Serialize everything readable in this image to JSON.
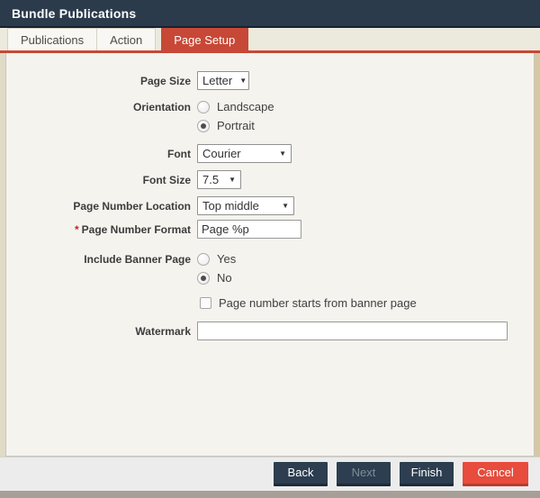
{
  "window": {
    "title": "Bundle Publications"
  },
  "tabs": [
    {
      "label": "Publications",
      "active": false
    },
    {
      "label": "Action",
      "active": false
    },
    {
      "label": "Page Setup",
      "active": true
    }
  ],
  "form": {
    "page_size": {
      "label": "Page Size",
      "value": "Letter"
    },
    "orientation": {
      "label": "Orientation",
      "options": [
        {
          "label": "Landscape",
          "selected": false
        },
        {
          "label": "Portrait",
          "selected": true
        }
      ]
    },
    "font": {
      "label": "Font",
      "value": "Courier"
    },
    "font_size": {
      "label": "Font Size",
      "value": "7.5"
    },
    "page_number_location": {
      "label": "Page Number Location",
      "value": "Top middle"
    },
    "page_number_format": {
      "label": "Page Number Format",
      "required_marker": "*",
      "value": "Page %p"
    },
    "include_banner_page": {
      "label": "Include Banner Page",
      "options": [
        {
          "label": "Yes",
          "selected": false
        },
        {
          "label": "No",
          "selected": true
        }
      ]
    },
    "banner_page_checkbox": {
      "label": "Page number starts from banner page",
      "checked": false
    },
    "watermark": {
      "label": "Watermark",
      "value": ""
    }
  },
  "footer": {
    "buttons": [
      {
        "label": "Back",
        "disabled": false
      },
      {
        "label": "Next",
        "disabled": true
      },
      {
        "label": "Finish",
        "disabled": false
      },
      {
        "label": "Cancel",
        "disabled": false
      }
    ]
  },
  "icons": {
    "dropdown_caret": "▼"
  },
  "colors": {
    "title_bar": "#2b3b4c",
    "accent_red": "#c74836",
    "cancel_red": "#e74c3c",
    "button_navy": "#2c3e50",
    "panel_bg": "#f4f3ee",
    "frame_beige": "#d7c8a2",
    "required_red": "#cc1f1a"
  }
}
